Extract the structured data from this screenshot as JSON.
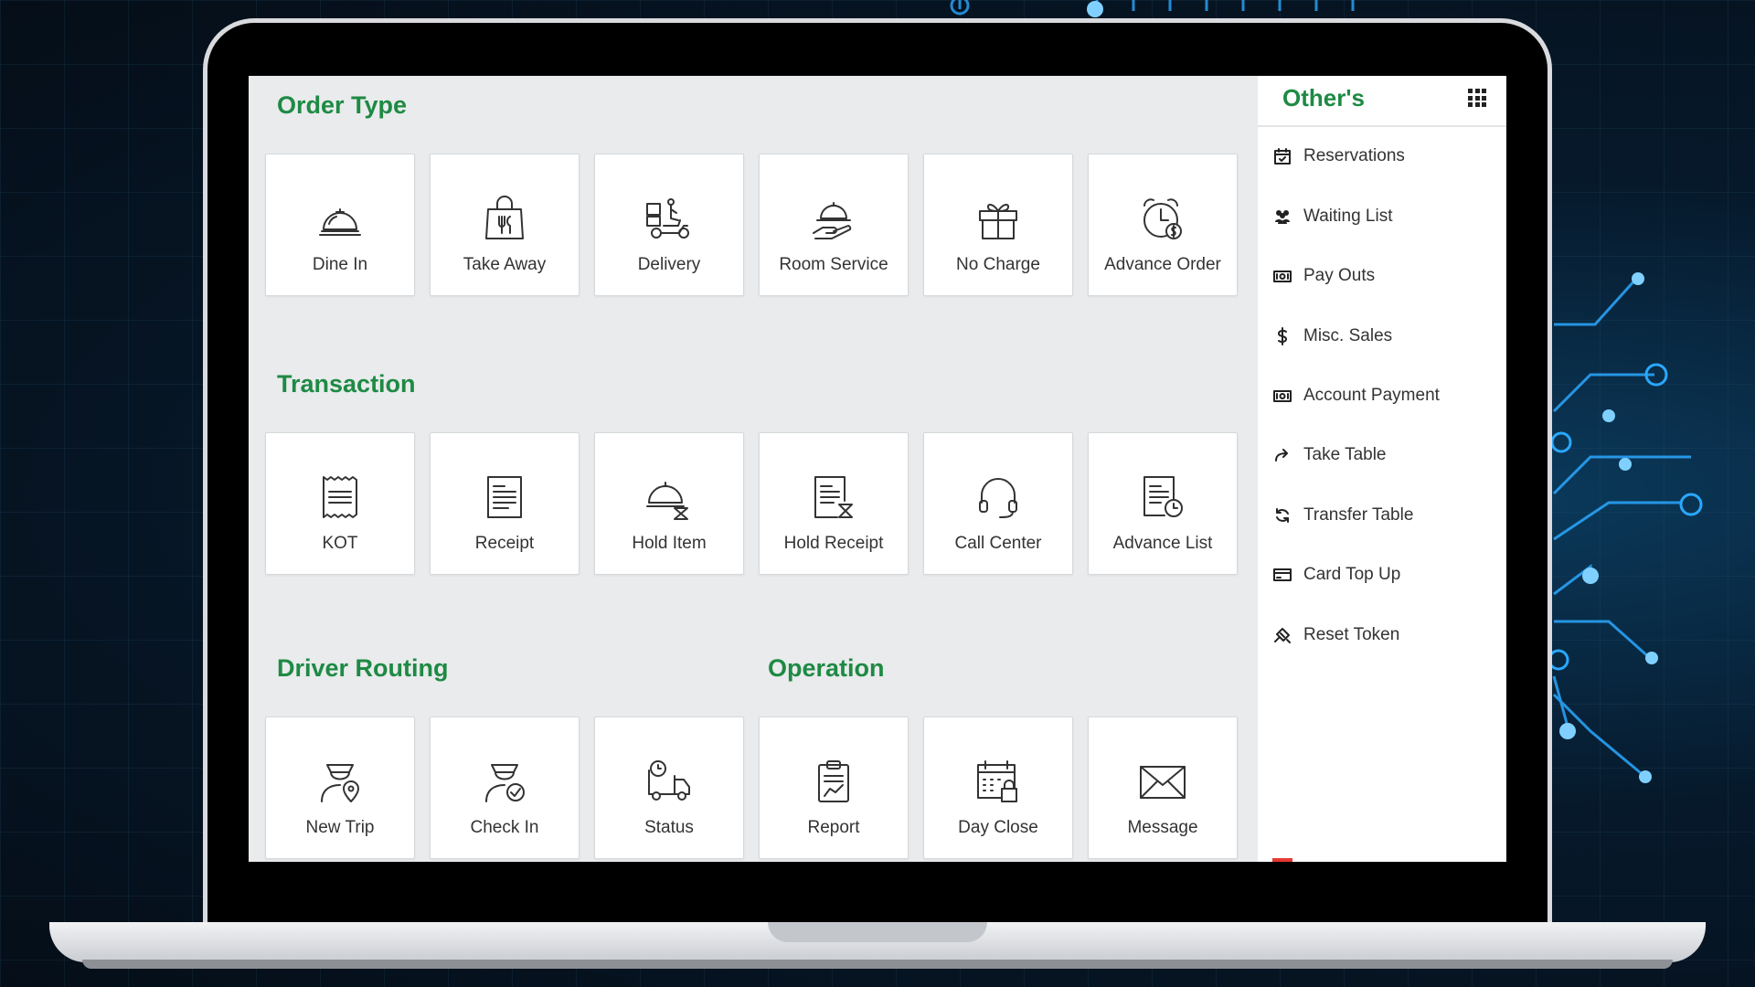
{
  "order_type": {
    "title": "Order Type",
    "items": [
      {
        "label": "Dine In",
        "icon": "cloche-icon"
      },
      {
        "label": "Take Away",
        "icon": "takeaway-bag-icon"
      },
      {
        "label": "Delivery",
        "icon": "delivery-scooter-icon"
      },
      {
        "label": "Room Service",
        "icon": "room-service-icon"
      },
      {
        "label": "No Charge",
        "icon": "gift-icon"
      },
      {
        "label": "Advance Order",
        "icon": "alarm-clock-dollar-icon"
      }
    ]
  },
  "transaction": {
    "title": "Transaction",
    "items": [
      {
        "label": "KOT",
        "icon": "kot-ticket-icon"
      },
      {
        "label": "Receipt",
        "icon": "receipt-icon"
      },
      {
        "label": "Hold Item",
        "icon": "hold-item-icon"
      },
      {
        "label": "Hold Receipt",
        "icon": "hold-receipt-icon"
      },
      {
        "label": "Call Center",
        "icon": "headset-icon"
      },
      {
        "label": "Advance List",
        "icon": "advance-list-icon"
      }
    ]
  },
  "driver_routing": {
    "title": "Driver Routing",
    "items": [
      {
        "label": "New Trip",
        "icon": "driver-location-icon"
      },
      {
        "label": "Check In",
        "icon": "driver-check-icon"
      },
      {
        "label": "Status",
        "icon": "truck-clock-icon"
      }
    ]
  },
  "operation": {
    "title": "Operation",
    "items": [
      {
        "label": "Report",
        "icon": "clipboard-chart-icon"
      },
      {
        "label": "Day Close",
        "icon": "calendar-lock-icon"
      },
      {
        "label": "Message",
        "icon": "envelope-icon"
      }
    ]
  },
  "sidebar": {
    "title": "Other's",
    "items": [
      {
        "label": "Reservations",
        "icon": "calendar-check-icon"
      },
      {
        "label": "Waiting List",
        "icon": "users-icon"
      },
      {
        "label": "Pay Outs",
        "icon": "money-bill-icon"
      },
      {
        "label": "Misc. Sales",
        "icon": "dollar-icon"
      },
      {
        "label": "Account Payment",
        "icon": "money-bill-icon"
      },
      {
        "label": "Take Table",
        "icon": "share-arrow-icon"
      },
      {
        "label": "Transfer Table",
        "icon": "refresh-icon"
      },
      {
        "label": "Card Top Up",
        "icon": "credit-card-icon"
      },
      {
        "label": "Reset Token",
        "icon": "reset-token-icon"
      }
    ]
  },
  "colors": {
    "accent": "#1e8a44",
    "panel_bg": "#e9ebec",
    "tile_bg": "#ffffff",
    "red_mark": "#e53935"
  }
}
